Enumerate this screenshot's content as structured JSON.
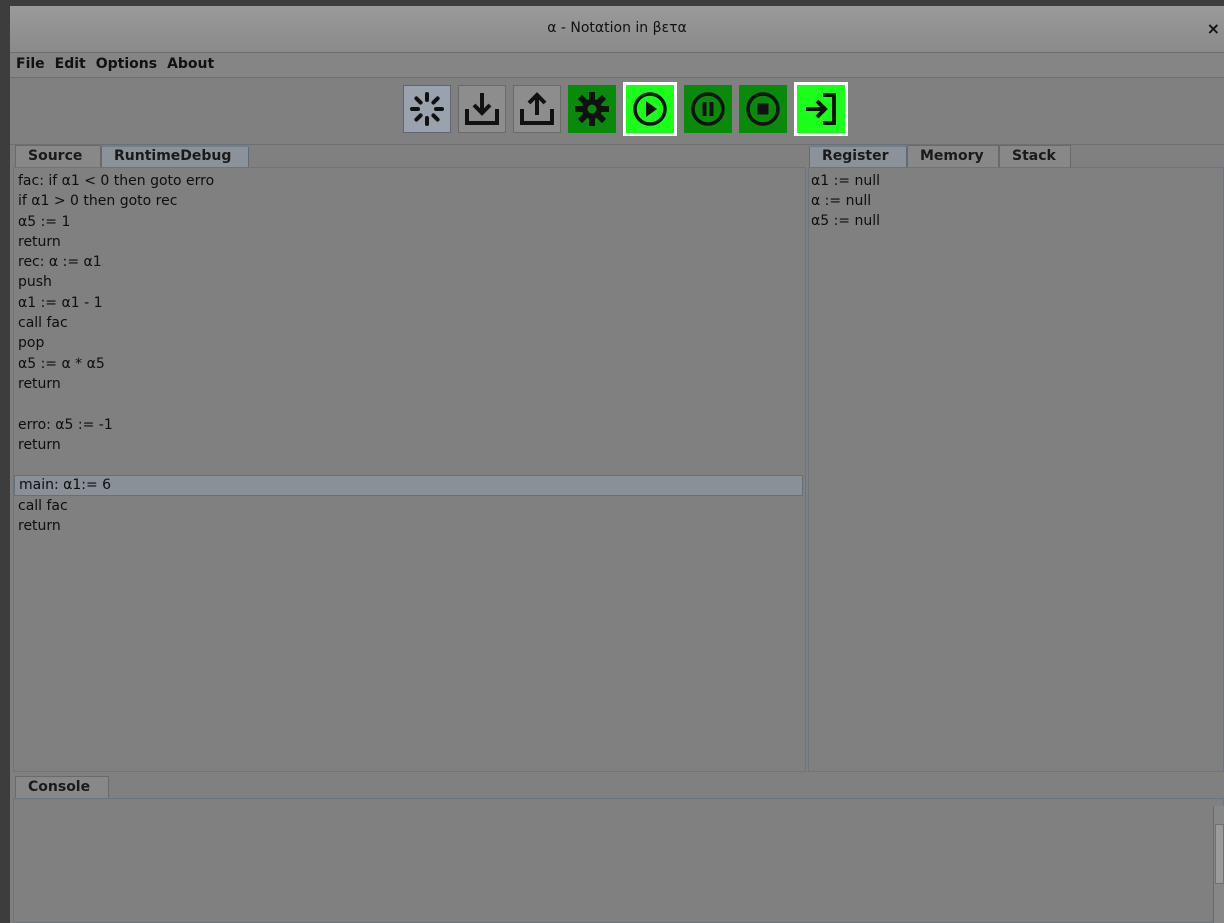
{
  "window": {
    "title": "α - Notαtion in βετα",
    "close_glyph": "×"
  },
  "menu": [
    "File",
    "Edit",
    "Options",
    "About"
  ],
  "toolbar": [
    {
      "name": "loading-spinner-icon"
    },
    {
      "name": "download-icon"
    },
    {
      "name": "upload-icon"
    },
    {
      "name": "gear-icon"
    },
    {
      "name": "play-icon"
    },
    {
      "name": "pause-icon"
    },
    {
      "name": "stop-icon"
    },
    {
      "name": "step-into-icon"
    }
  ],
  "colors": {
    "dark_green": "#0a8a0a",
    "bright_green": "#1aff1a",
    "panel_grey": "#808080"
  },
  "editor": {
    "tabs": [
      "Source",
      "RuntimeDebug"
    ],
    "active_tab": "RuntimeDebug",
    "lines": [
      "fac: if α1 < 0 then goto erro",
      "if α1 > 0 then goto rec",
      "α5 := 1",
      "return",
      "rec: α := α1",
      "push",
      "α1 := α1 - 1",
      "call fac",
      "pop",
      "α5 := α * α5",
      "return",
      "",
      "erro: α5 := -1",
      "return",
      "",
      "main: α1:= 6",
      "call fac",
      "return"
    ],
    "highlighted_line": 15
  },
  "inspector": {
    "tabs": [
      "Register",
      "Memory",
      "Stack"
    ],
    "active_tab": "Register",
    "registers": [
      "α1 := null",
      "α := null",
      "α5 := null"
    ]
  },
  "console": {
    "tab": "Console",
    "content": ""
  }
}
